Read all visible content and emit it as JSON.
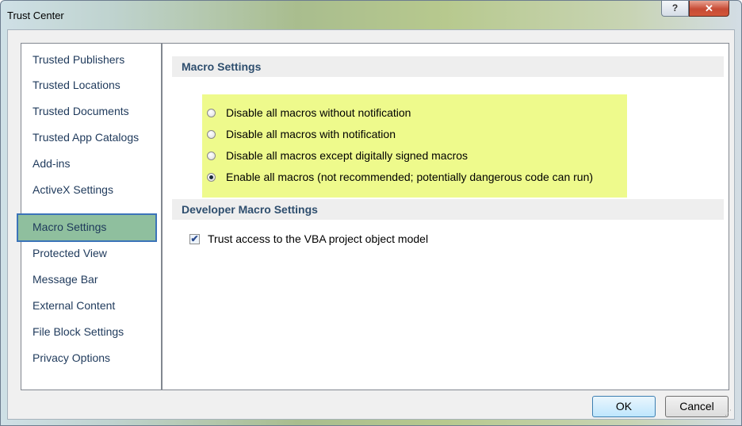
{
  "window": {
    "title": "Trust Center",
    "help_glyph": "?",
    "close_glyph": "✕"
  },
  "nav": {
    "items": [
      {
        "label": "Trusted Publishers"
      },
      {
        "label": "Trusted Locations"
      },
      {
        "label": "Trusted Documents"
      },
      {
        "label": "Trusted App Catalogs"
      },
      {
        "label": "Add-ins"
      },
      {
        "label": "ActiveX Settings"
      },
      {
        "label": "Macro Settings",
        "selected": true
      },
      {
        "label": "Protected View"
      },
      {
        "label": "Message Bar"
      },
      {
        "label": "External Content"
      },
      {
        "label": "File Block Settings"
      },
      {
        "label": "Privacy Options"
      }
    ]
  },
  "macro_settings": {
    "heading": "Macro Settings",
    "options": [
      {
        "label": "Disable all macros without notification",
        "selected": false
      },
      {
        "label": "Disable all macros with notification",
        "selected": false
      },
      {
        "label": "Disable all macros except digitally signed macros",
        "selected": false
      },
      {
        "label": "Enable all macros (not recommended; potentially dangerous code can run)",
        "selected": true
      }
    ],
    "highlight_color": "#eefa8c"
  },
  "developer_settings": {
    "heading": "Developer Macro Settings",
    "vba_access_label": "Trust access to the VBA project object model",
    "vba_access_checked": true,
    "check_glyph": "✔"
  },
  "footer": {
    "ok_label": "OK",
    "cancel_label": "Cancel"
  }
}
